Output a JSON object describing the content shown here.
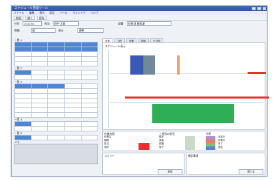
{
  "window": {
    "title": "スケジュール管理ツール"
  },
  "menu": {
    "items": [
      "ファイル",
      "編集",
      "表示",
      "設定",
      "ツール",
      "ウィンドウ",
      "ヘルプ"
    ]
  },
  "toolbar": {
    "new_label": "新規",
    "open_label": "開く",
    "save_label": "保存"
  },
  "filters": {
    "date_label": "日付",
    "date_value": "2012/01",
    "person_label": "担当",
    "person_value": "田中 太郎",
    "dept_label": "部署",
    "dept_value": "技術部 開発課",
    "period_label": "期間",
    "period_value": "週",
    "view_label": "表示",
    "view_value": "標準"
  },
  "left_sections": {
    "s1": "一覧 1",
    "s2": "一覧 2",
    "s3": "一覧 3",
    "s4": "一覧 4",
    "s5": "一覧 5",
    "memo": "メモ"
  },
  "tabs": [
    "全体",
    "工程",
    "作業",
    "詳細",
    "その他"
  ],
  "chart_label": "スケジュール表示",
  "bars": {
    "red_top": "#e8312b",
    "red_mid": "#e8312b",
    "green": "#2fae55",
    "blue": "#3a58b6",
    "orange": "#f2a05a"
  },
  "info_panel": {
    "title_left": "作業内容",
    "rows_left": [
      "作業名",
      "期間",
      "担当",
      "進捗"
    ],
    "title_mid": "工程別の状況",
    "rows_mid": [
      "設計",
      "実装",
      "試験",
      "保守"
    ],
    "title_right": "凡例",
    "legend": [
      "未着手",
      "作業中",
      "完了",
      "遅延"
    ]
  },
  "bottom": {
    "note_left": "コメント",
    "note_right": "補足事項",
    "btn_update": "更新",
    "btn_close": "閉じる"
  }
}
